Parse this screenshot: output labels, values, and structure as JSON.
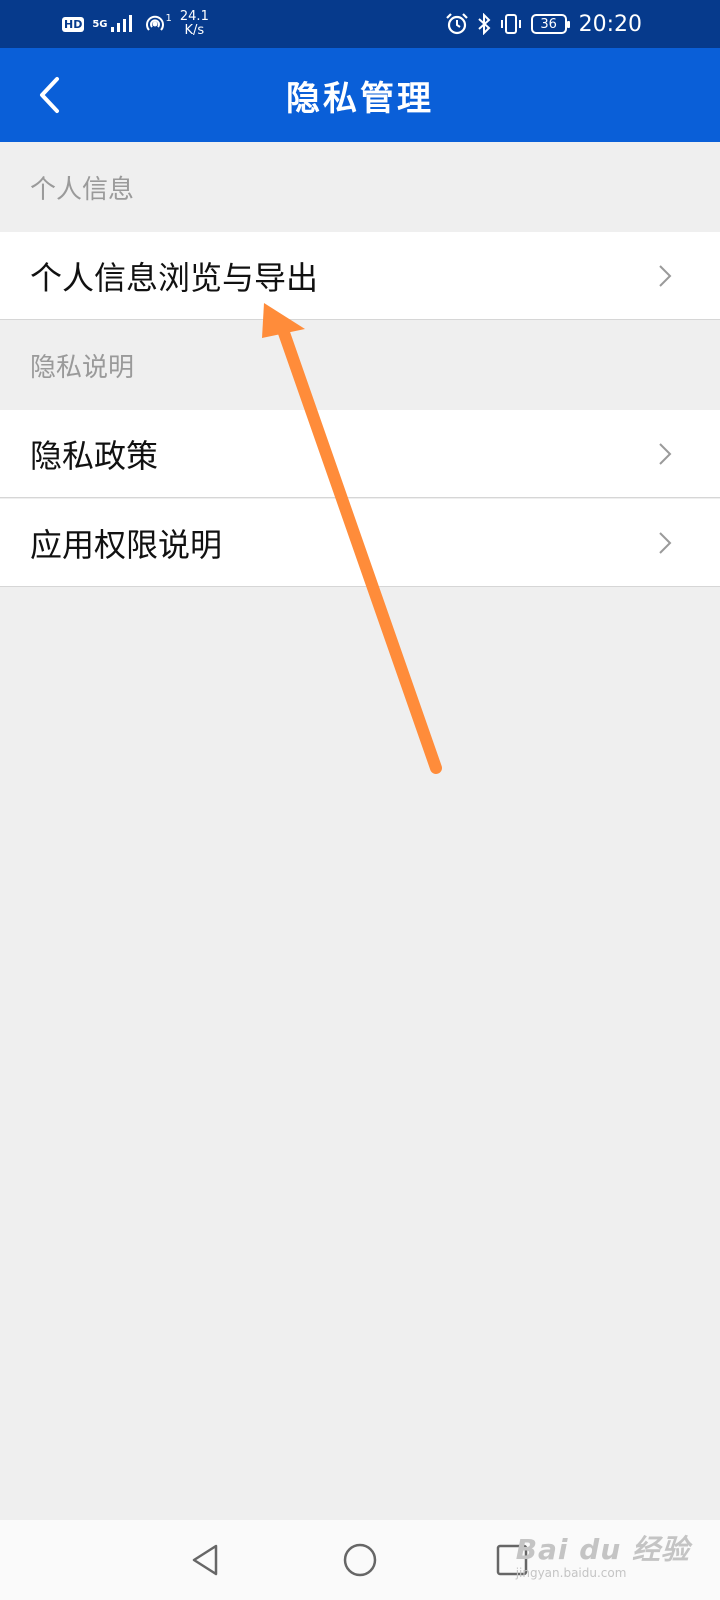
{
  "status_bar": {
    "hd": "HD",
    "network": "5G",
    "wifi_sub": "1",
    "speed_value": "24.1",
    "speed_unit": "K/s",
    "battery": "36",
    "time": "20:20"
  },
  "app_bar": {
    "title": "隐私管理",
    "back_icon": "back-arrow-icon"
  },
  "sections": {
    "personal": {
      "header": "个人信息",
      "items": [
        {
          "label": "个人信息浏览与导出"
        }
      ]
    },
    "privacy": {
      "header": "隐私说明",
      "items": [
        {
          "label": "隐私政策"
        },
        {
          "label": "应用权限说明"
        }
      ]
    }
  },
  "annotation": {
    "color": "#ff8c3a",
    "icon": "pointer-arrow"
  },
  "nav_bar": {
    "back": "triangle-back-icon",
    "home": "circle-home-icon",
    "recent": "square-recent-icon"
  },
  "watermark": {
    "main": "Bai du 经验",
    "sub": "jingyan.baidu.com"
  },
  "colors": {
    "status_bar": "#063a8c",
    "app_bar": "#0a5fd8",
    "background": "#efefef",
    "section_header_text": "#9a9a9a"
  }
}
